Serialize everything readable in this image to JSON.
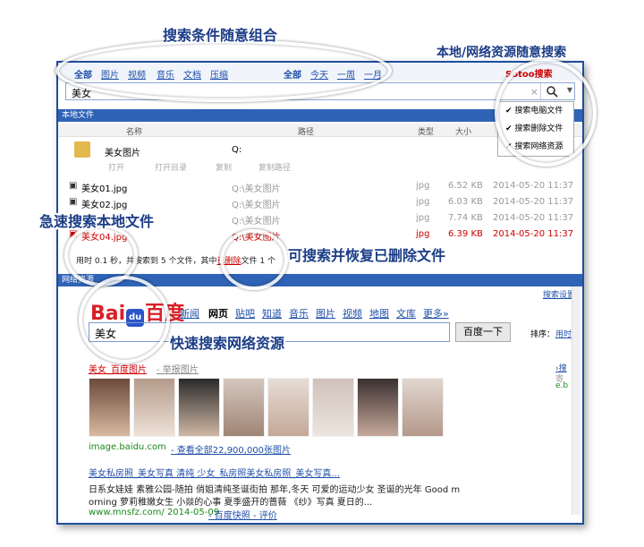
{
  "callouts": {
    "combine": "搜索条件随意组合",
    "local_network": "本地/网络资源随意搜索",
    "fast_local": "急速搜索本地文件",
    "recover": "可搜索并恢复已删除文件",
    "fast_network": "快速搜索网络资源"
  },
  "topbar": {
    "type_filters": [
      "全部",
      "图片",
      "视频",
      "音乐",
      "文档",
      "压缩"
    ],
    "time_filters": [
      "全部",
      "今天",
      "一周",
      "一月"
    ],
    "brand": "Sotoo搜索"
  },
  "search": {
    "value": "美女",
    "clear_icon": "×"
  },
  "dropdown": {
    "items": [
      "搜索电脑文件",
      "搜索删除文件",
      "搜索网络资源"
    ]
  },
  "local": {
    "section_title": "本地文件",
    "columns": [
      "名称",
      "路径",
      "类型",
      "大小"
    ],
    "folder": {
      "name": "美女图片",
      "path": "Q:"
    },
    "actions": [
      "打开",
      "打开目录",
      "复制",
      "复制路径"
    ],
    "files": [
      {
        "name": "美女01.jpg",
        "path": "Q:\\美女图片",
        "type": "jpg",
        "size": "6.52 KB",
        "date": "2014-05-20 11:37"
      },
      {
        "name": "美女02.jpg",
        "path": "Q:\\美女图片",
        "type": "jpg",
        "size": "6.03 KB",
        "date": "2014-05-20 11:37"
      },
      {
        "name": "美女03.jpg",
        "path": "Q:\\美女图片",
        "type": "jpg",
        "size": "7.74 KB",
        "date": "2014-05-20 11:37"
      },
      {
        "name": "美女04.jpg",
        "path": "Q:\\美女图片",
        "type": "jpg",
        "size": "6.39 KB",
        "date": "2014-05-20 11:37"
      }
    ],
    "status_prefix": "用时 0.1 秒，共搜索到 5 个文件，其中",
    "status_deleted": "已删除",
    "status_suffix": "文件 1 个"
  },
  "network": {
    "section_title": "网络资源",
    "top_right": "搜索设置",
    "logo_text": "Bai",
    "logo_paw": "du",
    "logo_cn": "百度",
    "nav": [
      "新闻",
      "网页",
      "贴吧",
      "知道",
      "音乐",
      "图片",
      "视频",
      "地图",
      "文库",
      "更多»"
    ],
    "query": "美女",
    "button": "百度一下",
    "sort_label": "排序：",
    "sort_value": "用时",
    "result1_title": "美女_百度图片",
    "result1_sub": "- 举报图片",
    "result1_url": "image.baidu.com",
    "result1_more": "- 查看全部22,900,000张图片",
    "result2_title": "美女私房照_美女写真 清纯 少女_私房照美女私房照_美女写真...",
    "result2_line1": "日系女娃娃 素雅公园-随拍 俏姐清纯圣诞街拍 那年,冬天 可爱的运动少女 圣诞的光年 Good m",
    "result2_line2": "orning 萝莉稚嫩女生 小燚的心事 夏季盛开的蔷薇 《纱》写真 夏日的...",
    "result2_url": "www.mnsfz.com/ 2014-05-09",
    "result2_links": "- 百度快照 - 评价",
    "side_link": "›搜",
    "side_text": "寄",
    "side_url": "e.b"
  },
  "colors": {
    "brand": "#1e4e9c",
    "accent": "#2f63b6",
    "link": "#1f4fa8",
    "deleted": "#cc0000",
    "green": "#1a8a1a"
  }
}
